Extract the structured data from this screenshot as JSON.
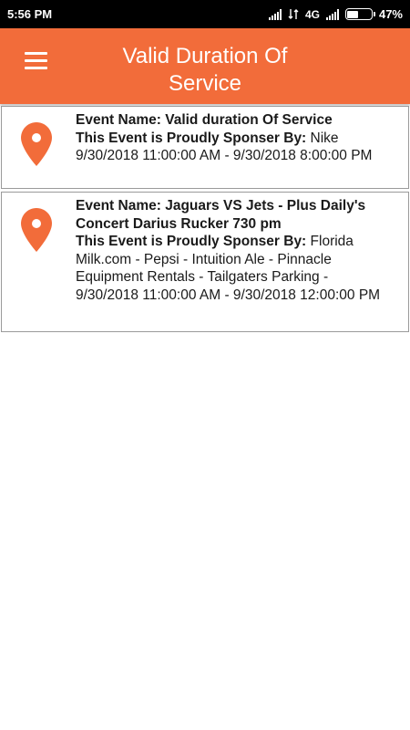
{
  "status_bar": {
    "time": "5:56 PM",
    "network": "4G",
    "battery_percent": "47%",
    "battery_level": 0.47
  },
  "app_bar": {
    "title": "Valid Duration Of Service",
    "menu_icon": "hamburger-menu-icon"
  },
  "colors": {
    "accent": "#f26c3a",
    "pin": "#f26c3a"
  },
  "events": [
    {
      "name_label": "Event Name:",
      "name": "Valid duration Of Service",
      "sponsor_label": "This Event is Proudly Sponser By:",
      "sponsors": "Nike",
      "datetime": "9/30/2018 11:00:00 AM - 9/30/2018 8:00:00 PM",
      "icon": "location-pin-icon"
    },
    {
      "name_label": "Event Name:",
      "name": "Jaguars VS Jets - Plus Daily's Concert Darius Rucker 730 pm",
      "sponsor_label": "This Event is Proudly Sponser By:",
      "sponsors": "Florida Milk.com - Pepsi - Intuition Ale - Pinnacle Equipment Rentals - Tailgaters Parking -",
      "datetime": "9/30/2018 11:00:00 AM - 9/30/2018 12:00:00 PM",
      "icon": "location-pin-icon"
    }
  ]
}
